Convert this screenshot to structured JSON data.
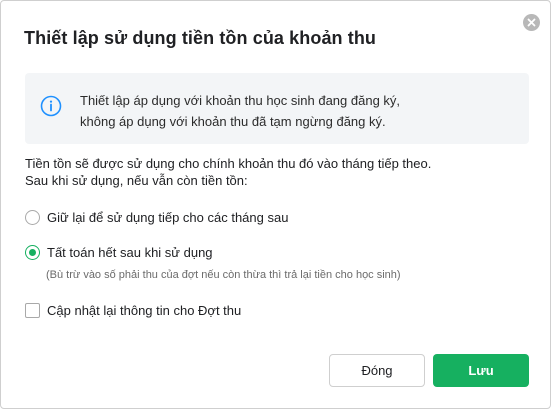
{
  "dialog": {
    "title": "Thiết lập sử dụng tiền tồn của khoản thu"
  },
  "info": {
    "icon": "info-icon",
    "line1": "Thiết lập áp dụng với khoản thu học sinh đang đăng ký,",
    "line2": "không áp dụng với khoản thu đã tạm ngừng đăng ký."
  },
  "description": {
    "line1": "Tiền tồn sẽ được sử dụng cho chính khoản thu đó vào tháng tiếp theo.",
    "line2": "Sau khi sử dụng, nếu vẫn còn tiền tồn:"
  },
  "options": [
    {
      "label": "Giữ lại để sử dụng tiếp cho các tháng sau",
      "checked": false
    },
    {
      "label": "Tất toán hết sau khi sử dụng",
      "checked": true
    }
  ],
  "option_note": "(Bù trừ vào số phải thu của đợt nếu còn thừa thì trả lại tiền cho học sinh)",
  "checkbox": {
    "label": "Cập nhật lại thông tin cho Đợt thu",
    "checked": false
  },
  "buttons": {
    "cancel_label": "Đóng",
    "save_label": "Lưu"
  },
  "colors": {
    "accent": "#16b060",
    "info_bg": "#f3f5f7",
    "info_icon": "#1e90ff"
  }
}
